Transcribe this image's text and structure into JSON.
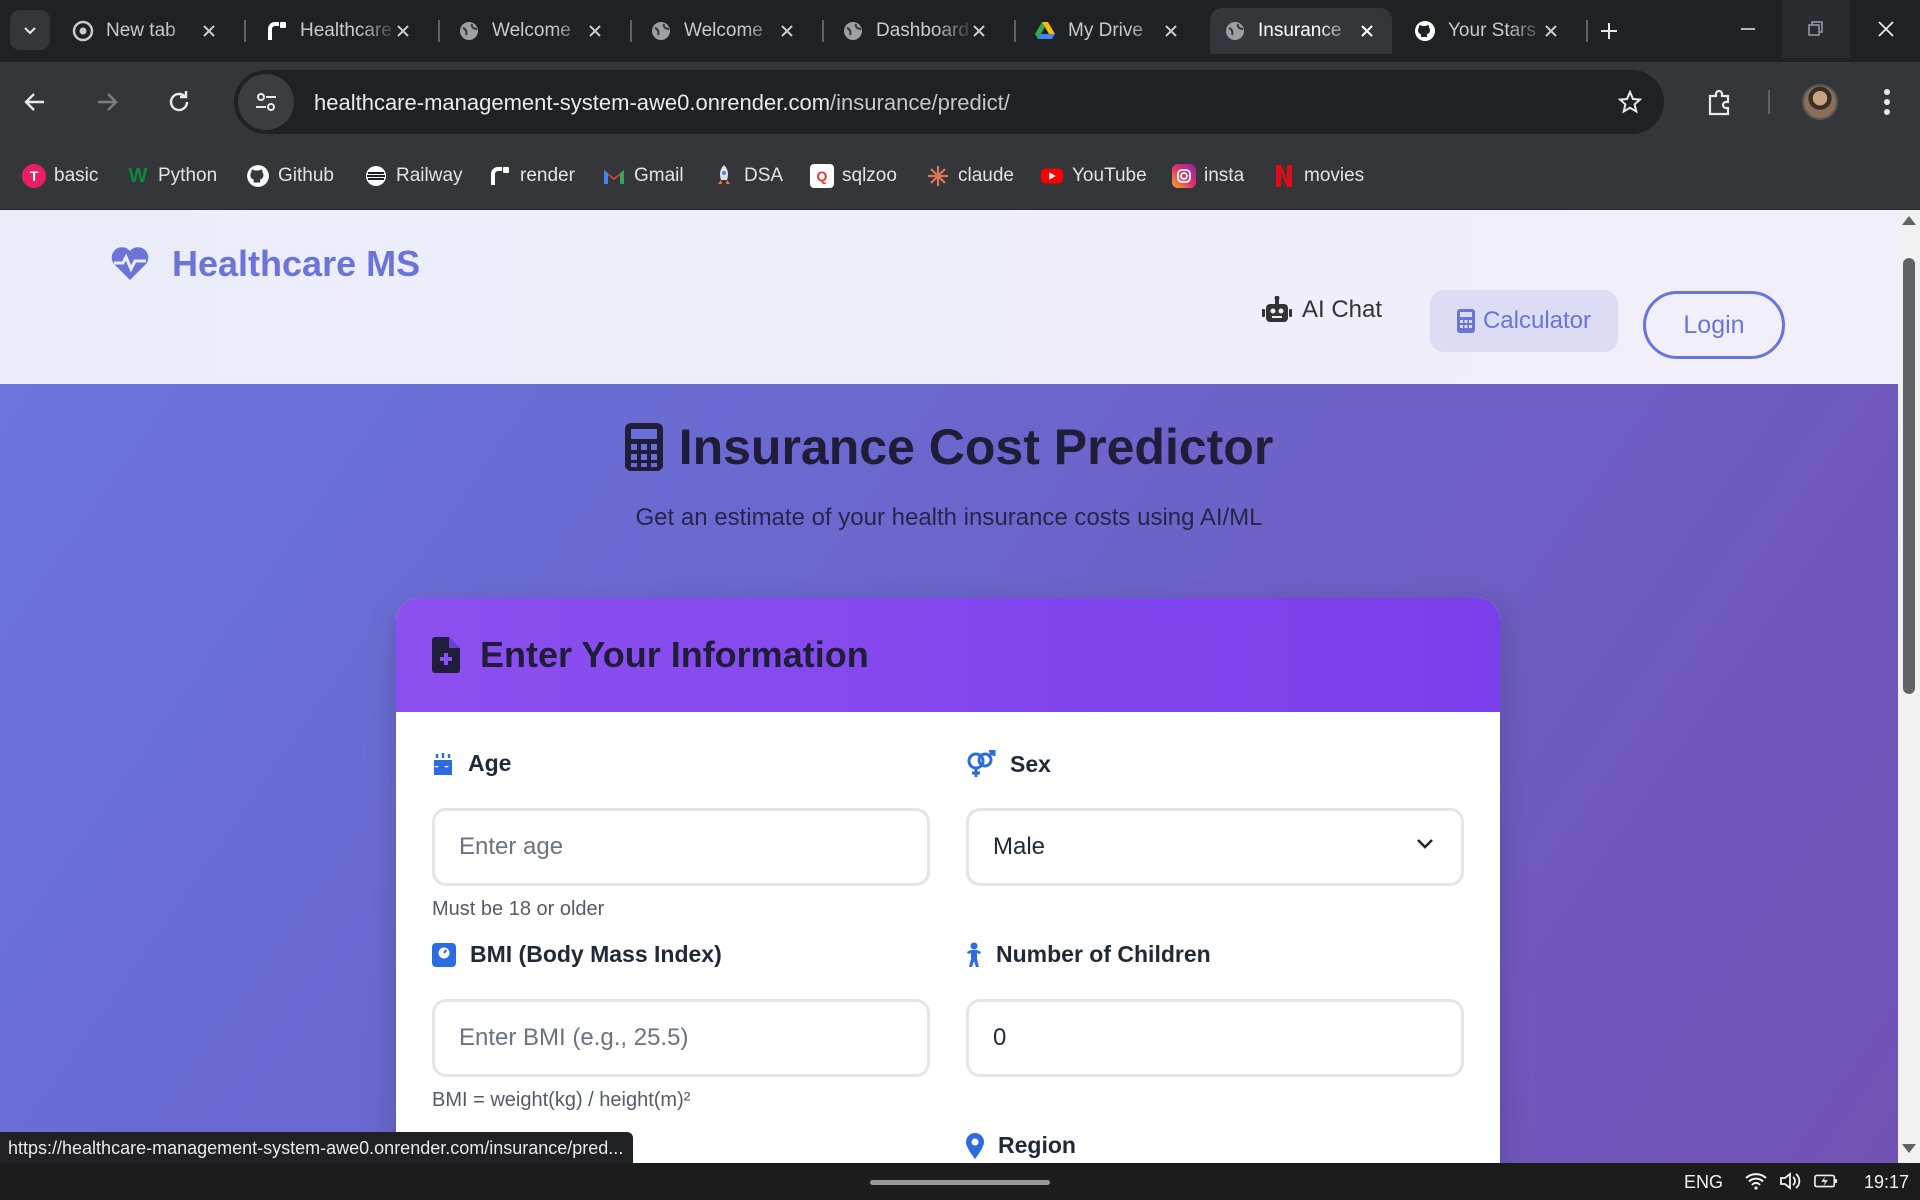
{
  "browser": {
    "tabs": [
      {
        "title": "New tab",
        "icon": "chrome-icon",
        "active": false
      },
      {
        "title": "Healthcare",
        "icon": "render-icon",
        "active": false
      },
      {
        "title": "Welcome",
        "icon": "globe-icon",
        "active": false
      },
      {
        "title": "Welcome",
        "icon": "globe-icon",
        "active": false
      },
      {
        "title": "Dashboard",
        "icon": "globe-icon",
        "active": false
      },
      {
        "title": "My Drive",
        "icon": "google-drive-icon",
        "active": false
      },
      {
        "title": "Insurance",
        "icon": "globe-icon",
        "active": true
      },
      {
        "title": "Your Stars",
        "icon": "github-icon",
        "active": false
      }
    ],
    "url_host": "healthcare-management-system-awe0.onrender.com",
    "url_path": "/insurance/predict/",
    "bookmarks": [
      {
        "label": "basic",
        "icon": "basic-icon",
        "color": "#e91e63"
      },
      {
        "label": "Python",
        "icon": "python-w-icon",
        "color": "#0a8a3a"
      },
      {
        "label": "Github",
        "icon": "github-icon",
        "color": "#ffffff"
      },
      {
        "label": "Railway",
        "icon": "railway-icon",
        "color": "#ffffff"
      },
      {
        "label": "render",
        "icon": "render-icon",
        "color": "#ffffff"
      },
      {
        "label": "Gmail",
        "icon": "gmail-icon",
        "color": "#ea4335"
      },
      {
        "label": "DSA",
        "icon": "rocket-icon",
        "color": "#e0e0e0"
      },
      {
        "label": "sqlzoo",
        "icon": "sqlzoo-icon",
        "color": "#e53935"
      },
      {
        "label": "claude",
        "icon": "claude-icon",
        "color": "#d97757"
      },
      {
        "label": "YouTube",
        "icon": "youtube-icon",
        "color": "#ff0000"
      },
      {
        "label": "insta",
        "icon": "instagram-icon",
        "color": "#e1306c"
      },
      {
        "label": "movies",
        "icon": "netflix-icon",
        "color": "#e50914"
      }
    ],
    "status_url": "https://healthcare-management-system-awe0.onrender.com/insurance/pred..."
  },
  "navbar": {
    "brand": "Healthcare MS",
    "ai_chat": "AI Chat",
    "calculator": "Calculator",
    "login": "Login"
  },
  "hero": {
    "title": "Insurance Cost Predictor",
    "subtitle": "Get an estimate of your health insurance costs using AI/ML"
  },
  "form": {
    "header": "Enter Your Information",
    "age": {
      "label": "Age",
      "placeholder": "Enter age",
      "hint": "Must be 18 or older"
    },
    "sex": {
      "label": "Sex",
      "value": "Male"
    },
    "bmi": {
      "label": "BMI (Body Mass Index)",
      "placeholder": "Enter BMI (e.g., 25.5)",
      "hint": "BMI = weight(kg) / height(m)²"
    },
    "children": {
      "label": "Number of Children",
      "value": "0"
    },
    "region": {
      "label": "Region"
    }
  },
  "taskbar": {
    "language": "ENG",
    "time": "19:17"
  },
  "colors": {
    "accent": "#6b74d8",
    "card_header": "#8c50f0",
    "page_gradient_start": "#6a77df",
    "page_gradient_end": "#7151b4"
  }
}
